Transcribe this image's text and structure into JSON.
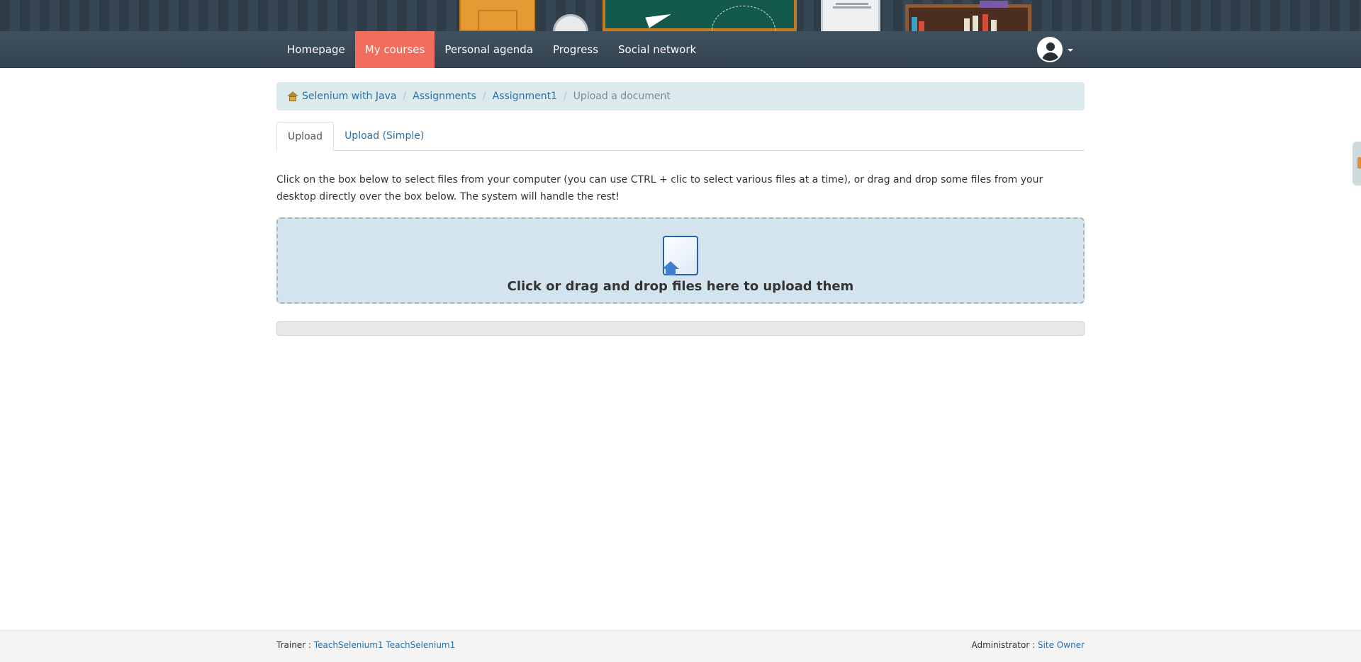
{
  "nav": {
    "items": [
      "Homepage",
      "My courses",
      "Personal agenda",
      "Progress",
      "Social network"
    ],
    "active_index": 1
  },
  "breadcrumb": {
    "course": "Selenium with Java",
    "section": "Assignments",
    "item": "Assignment1",
    "current": "Upload a document"
  },
  "tabs": [
    "Upload",
    "Upload (Simple)"
  ],
  "instructions": "Click on the box below to select files from your computer (you can use CTRL + clic to select various files at a time), or drag and drop some files from your desktop directly over the box below. The system will handle the rest!",
  "dropzone": {
    "label": "Click or drag and drop files here to upload them"
  },
  "upload_progress": 0,
  "footer": {
    "trainer_label": "Trainer :",
    "trainer_name": "TeachSelenium1 TeachSelenium1",
    "admin_label": "Administrator :",
    "admin_name": "Site Owner"
  },
  "colors": {
    "accent_active": "#f26d5b",
    "link": "#2c6fa7",
    "breadcrumb_bg": "#daeaed",
    "dropzone_bg": "#d3e4ef"
  },
  "icons": [
    "home-icon",
    "upload-document-icon",
    "user-avatar-icon",
    "caret-down-icon"
  ]
}
